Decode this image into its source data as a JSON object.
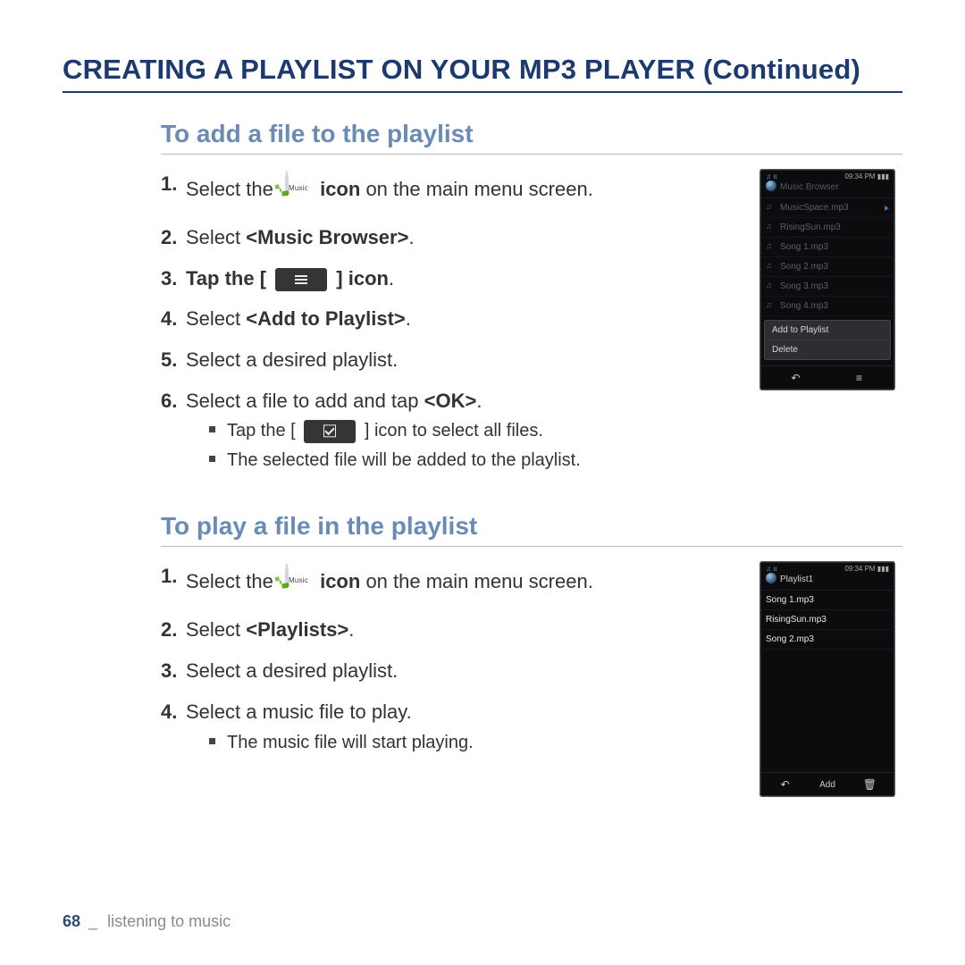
{
  "page": {
    "title": "CREATING A PLAYLIST ON YOUR MP3 PLAYER (Continued)",
    "number": "68",
    "footer_sep": "_",
    "footer_text": "listening to music"
  },
  "icons": {
    "music_label": "Music"
  },
  "sectionA": {
    "title": "To add a file to the playlist",
    "step1_a": "Select the ",
    "step1_b_bold": "icon",
    "step1_c": " on the main menu screen.",
    "step2_a": "Select ",
    "step2_b_bold": "<Music Browser>",
    "step2_c": ".",
    "step3_a": "Tap the ",
    "step3_b_bold_open": "[",
    "step3_b_bold_close": "] icon",
    "step3_c": ".",
    "step4_a": "Select ",
    "step4_b_bold": "<Add to Playlist>",
    "step4_c": ".",
    "step5": "Select a desired playlist.",
    "step6_a": "Select a file to add and tap ",
    "step6_b_bold": "<OK>",
    "step6_c": ".",
    "note1_a": "Tap the [",
    "note1_b": "] icon to select all files.",
    "note2": "The selected file will be added to the playlist."
  },
  "sectionB": {
    "title": "To play a file in the playlist",
    "step1_a": "Select the ",
    "step1_b_bold": "icon",
    "step1_c": " on the main menu screen.",
    "step2_a": "Select ",
    "step2_b_bold": "<Playlists>",
    "step2_c": ".",
    "step3": "Select a desired playlist.",
    "step4": "Select a music file to play.",
    "note1": "The music file will start playing."
  },
  "screenA": {
    "status_left": "♫ ıı",
    "status_right": "09:34 PM  ▮▮▮",
    "header": "Music Browser",
    "rows": [
      "MusicSpace.mp3",
      "RisingSun.mp3",
      "Song 1.mp3",
      "Song 2.mp3",
      "Song 3.mp3",
      "Song 4.mp3"
    ],
    "popup": [
      "Add to Playlist",
      "Delete"
    ],
    "btn_back": "↶",
    "btn_menu": "≡"
  },
  "screenB": {
    "status_left": "♫ ıı",
    "status_right": "09:34 PM  ▮▮▮",
    "header": "Playlist1",
    "rows": [
      "Song 1.mp3",
      "RisingSun.mp3",
      "Song 2.mp3"
    ],
    "btn_back": "↶",
    "btn_add": "Add",
    "btn_trash": "🗑"
  }
}
